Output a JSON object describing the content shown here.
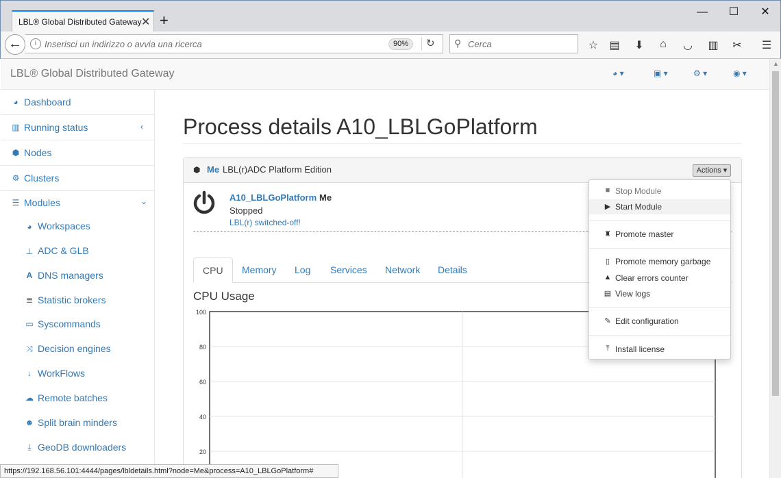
{
  "browser": {
    "tab_title": "LBL® Global Distributed Gateway",
    "url_placeholder": "Inserisci un indirizzo o avvia una ricerca",
    "zoom": "90%",
    "search_placeholder": "Cerca",
    "status_url": "https://192.168.56.101:4444/pages/lbldetails.html?node=Me&process=A10_LBLGoPlatform#"
  },
  "app": {
    "brand": "LBL® Global Distributed Gateway"
  },
  "sidebar": {
    "items": [
      {
        "label": "Dashboard",
        "icon": "dashboard-icon"
      },
      {
        "label": "Running status",
        "icon": "bar-chart-icon"
      },
      {
        "label": "Nodes",
        "icon": "cube-icon"
      },
      {
        "label": "Clusters",
        "icon": "cogs-icon"
      },
      {
        "label": "Modules",
        "icon": "list-icon"
      }
    ],
    "subitems": [
      {
        "label": "Workspaces",
        "icon": "dashboard-icon"
      },
      {
        "label": "ADC & GLB",
        "icon": "sitemap-icon"
      },
      {
        "label": "DNS managers",
        "icon": "font-icon"
      },
      {
        "label": "Statistic brokers",
        "icon": "database-icon"
      },
      {
        "label": "Syscommands",
        "icon": "laptop-icon"
      },
      {
        "label": "Decision engines",
        "icon": "random-icon"
      },
      {
        "label": "WorkFlows",
        "icon": "sort-numeric-icon"
      },
      {
        "label": "Remote batches",
        "icon": "cloud-upload-icon"
      },
      {
        "label": "Split brain minders",
        "icon": "users-icon"
      },
      {
        "label": "GeoDB downloaders",
        "icon": "download-icon"
      }
    ]
  },
  "main": {
    "page_title": "Process details A10_LBLGoPlatform",
    "panel_node": "Me",
    "panel_edition": "LBL(r)ADC Platform Edition",
    "actions_label": "Actions",
    "process_name": "A10_LBLGoPlatform",
    "process_node": "Me",
    "process_status": "Stopped",
    "process_message": "LBL(r) switched-off!",
    "tabs": [
      "CPU",
      "Memory",
      "Log",
      "Services",
      "Network",
      "Details"
    ],
    "cpu_title": "CPU Usage"
  },
  "dropdown": {
    "items": [
      {
        "label": "Stop Module",
        "icon": "stop-icon"
      },
      {
        "label": "Start Module",
        "icon": "play-icon"
      },
      {
        "label": "Promote master",
        "icon": "trophy-icon"
      },
      {
        "label": "Promote memory garbage",
        "icon": "trash-icon"
      },
      {
        "label": "Clear errors counter",
        "icon": "warning-icon"
      },
      {
        "label": "View logs",
        "icon": "file-text-icon"
      },
      {
        "label": "Edit configuration",
        "icon": "edit-icon"
      },
      {
        "label": "Install license",
        "icon": "upload-icon"
      }
    ]
  },
  "chart_data": {
    "type": "line",
    "title": "CPU Usage",
    "ylim": [
      0,
      100
    ],
    "yticks": [
      "100",
      "80",
      "60",
      "40",
      "20"
    ],
    "series": [],
    "grid": true
  }
}
